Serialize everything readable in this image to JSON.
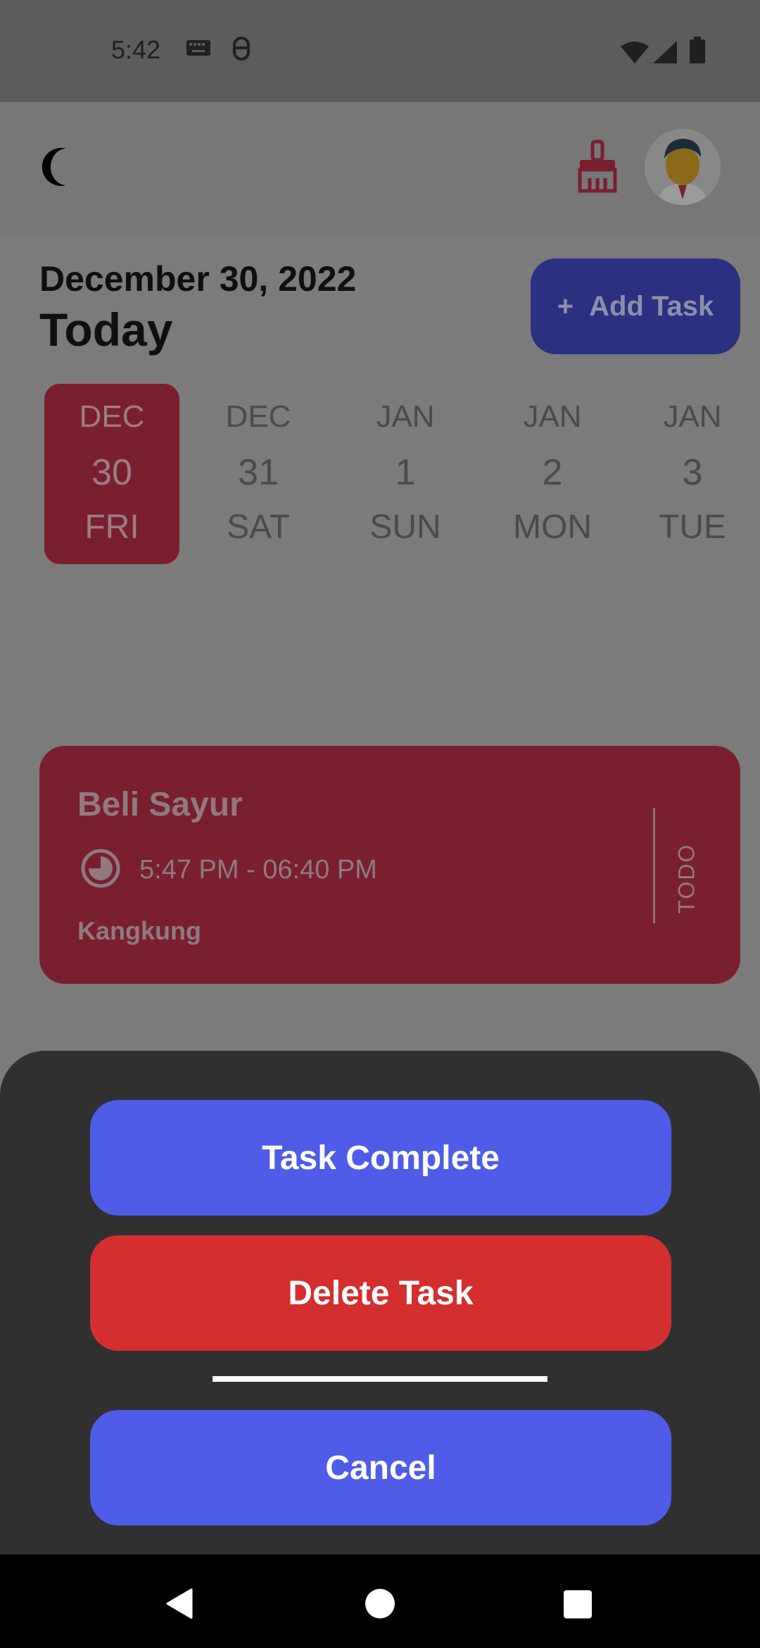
{
  "status_bar": {
    "time": "5:42",
    "icons": [
      "keyboard-icon",
      "vpn-icon",
      "wifi-icon",
      "signal-icon",
      "battery-icon"
    ]
  },
  "header": {
    "theme_icon": "moon-icon",
    "clear_icon": "broom-icon",
    "avatar": "avatar"
  },
  "date_header": {
    "date": "December 30, 2022",
    "label": "Today",
    "add_task_label": "Add Task",
    "add_task_icon": "+"
  },
  "calendar": {
    "days": [
      {
        "month": "DEC",
        "day": "30",
        "weekday": "FRI",
        "selected": true
      },
      {
        "month": "DEC",
        "day": "31",
        "weekday": "SAT",
        "selected": false
      },
      {
        "month": "JAN",
        "day": "1",
        "weekday": "SUN",
        "selected": false
      },
      {
        "month": "JAN",
        "day": "2",
        "weekday": "MON",
        "selected": false
      },
      {
        "month": "JAN",
        "day": "3",
        "weekday": "TUE",
        "selected": false
      }
    ]
  },
  "task": {
    "title": "Beli Sayur",
    "time": "5:47 PM - 06:40 PM",
    "note": "Kangkung",
    "status": "TODO",
    "color": "#7a1f2e"
  },
  "sheet": {
    "complete_label": "Task Complete",
    "delete_label": "Delete Task",
    "cancel_label": "Cancel"
  },
  "colors": {
    "accent": "#4f5ce8",
    "danger": "#d32f2f",
    "selected_day": "#7a1f2e"
  }
}
